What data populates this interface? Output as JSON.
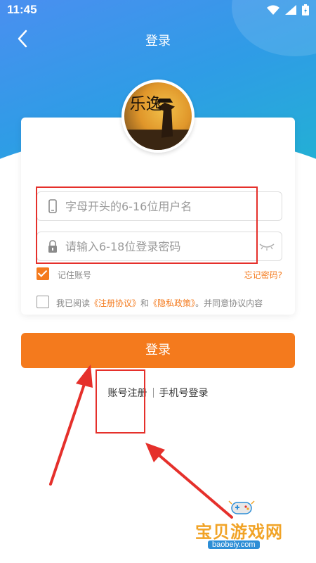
{
  "status_bar": {
    "time": "11:45"
  },
  "header": {
    "title": "登录"
  },
  "avatar": {
    "art_text": "乐逸"
  },
  "form": {
    "username_placeholder": "字母开头的6-16位用户名",
    "password_placeholder": "请输入6-18位登录密码",
    "remember_label": "记住账号",
    "remember_checked": true,
    "forgot_label": "忘记密码?",
    "agreement": {
      "checked": false,
      "prefix": "我已阅读",
      "terms_link": "《注册协议》",
      "and": "和",
      "privacy_link": "《隐私政策》",
      "suffix": "。并同意协议内容"
    },
    "login_button": "登录"
  },
  "alt_links": {
    "register": "账号注册",
    "phone_login": "手机号登录"
  },
  "watermark": {
    "text": "宝贝游戏网",
    "url": "baobeiy.com"
  },
  "colors": {
    "accent": "#f47a1d",
    "header_gradient_start": "#4a8ff0",
    "header_gradient_end": "#1fb6cf",
    "annotation": "#e5302b"
  }
}
